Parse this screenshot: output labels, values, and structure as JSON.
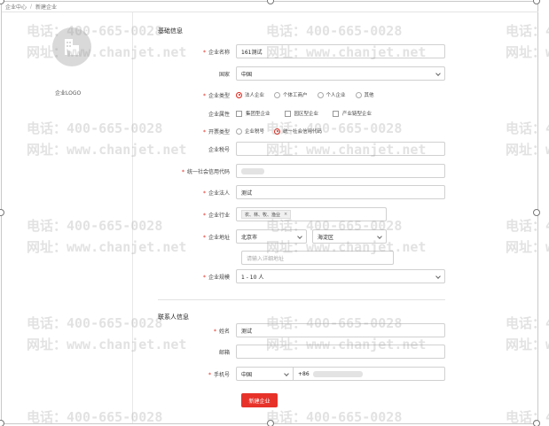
{
  "breadcrumb": [
    "企业中心",
    "新建企业"
  ],
  "breadcrumb_sep": "/",
  "logo": {
    "label": "企业LOGO"
  },
  "basic": {
    "section_title": "基础信息",
    "company_name": {
      "label": "企业名称",
      "value": "161测试"
    },
    "country": {
      "label": "国家",
      "value": "中国"
    },
    "company_type": {
      "label": "企业类型",
      "options": [
        "法人企业",
        "个体工商户",
        "个人企业",
        "其他"
      ],
      "selected": 0
    },
    "company_attr": {
      "label": "企业属性",
      "options": [
        "集团型企业",
        "园区型企业",
        "产业链型企业"
      ]
    },
    "invoice_type": {
      "label": "开票类型",
      "options": [
        "企业税号",
        "统一社会信用代码"
      ],
      "selected": 1
    },
    "tax_no": {
      "label": "企业税号",
      "value": ""
    },
    "credit_code": {
      "label": "统一社会信用代码"
    },
    "legal_person": {
      "label": "企业法人",
      "value": "测试"
    },
    "industry": {
      "label": "企业行业",
      "tag": "农、林、牧、渔业",
      "close": "×"
    },
    "address": {
      "label": "企业地址",
      "city": "北京市",
      "district": "海淀区",
      "detail_placeholder": "请输入详细地址"
    },
    "scale": {
      "label": "企业规模",
      "value": "1 - 10 人"
    }
  },
  "contact": {
    "section_title": "联系人信息",
    "name": {
      "label": "姓名",
      "value": "测试"
    },
    "email": {
      "label": "邮箱",
      "value": ""
    },
    "phone": {
      "label": "手机号",
      "country": "中国",
      "prefix": "+86"
    }
  },
  "submit_label": "新建企业",
  "watermark": {
    "line1": "电话：400-665-0028",
    "line2": "网址：www.chanjet.net"
  },
  "colors": {
    "accent": "#e7322a",
    "required": "#e0261b"
  }
}
